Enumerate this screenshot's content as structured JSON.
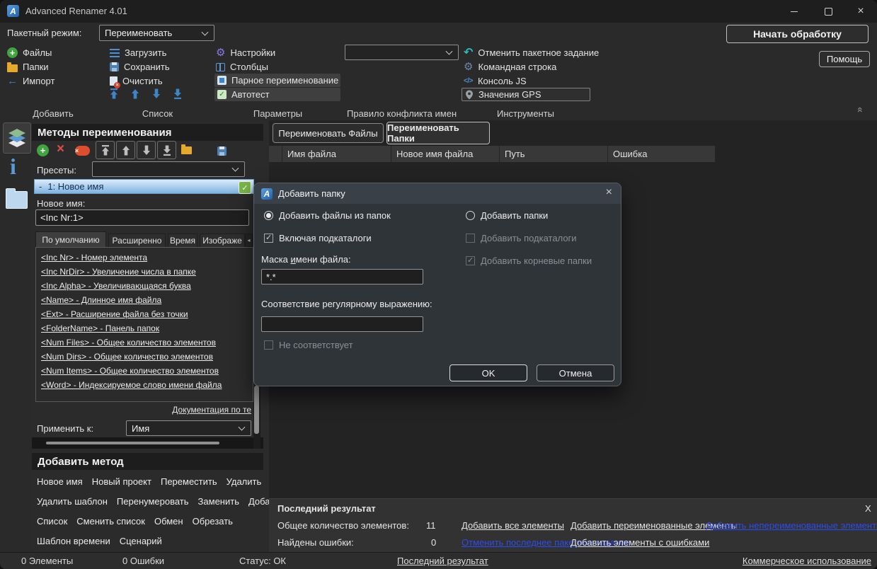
{
  "window": {
    "title": "Advanced Renamer 4.01"
  },
  "topbar": {
    "batch_mode_label": "Пакетный режим:",
    "batch_mode_value": "Переименовать",
    "start_button": "Начать обработку",
    "help_button": "Помощь"
  },
  "ribbon": {
    "groups": {
      "add": {
        "label": "Добавить",
        "files": "Файлы",
        "folders": "Папки",
        "import": "Импорт"
      },
      "list": {
        "label": "Список",
        "load": "Загрузить",
        "save": "Сохранить",
        "clear": "Очистить"
      },
      "params": {
        "label": "Параметры",
        "settings": "Настройки",
        "columns": "Столбцы",
        "pair": "Парное переименование",
        "autotest": "Автотест"
      },
      "conflict": {
        "label": "Правило конфликта имен",
        "combo_value": ""
      },
      "tools": {
        "label": "Инструменты",
        "undo_batch": "Отменить пакетное задание",
        "cmdline": "Командная строка",
        "jsconsole": "Консоль JS",
        "gps": "Значения GPS"
      }
    }
  },
  "methods_panel": {
    "title": "Методы переименования",
    "presets_label": "Пресеты:",
    "presets_value": "",
    "method_collapse": "-",
    "method_row": "1: Новое имя",
    "new_name_label": "Новое имя:",
    "new_name_value": "<Inc Nr:1>",
    "tabs": [
      "По умолчанию",
      "Расширенно",
      "Время",
      "Изображе"
    ],
    "tags": [
      "<Inc Nr> - Номер элемента",
      "<Inc NrDir> - Увеличение числа в папке",
      "<Inc Alpha> - Увеличивающаяся буква",
      "<Name> - Длинное имя файла",
      "<Ext> - Расширение файла без точки",
      "<FolderName> - Панель папок",
      "<Num Files> - Общее количество элементов",
      "<Num Dirs> - Общее количество элементов",
      "<Num Items> - Общее количество элементов",
      "<Word> - Индексируемое слово имени файла"
    ],
    "doc_link": "Документация по те",
    "apply_label": "Применить к:",
    "apply_value": "Имя"
  },
  "add_method_panel": {
    "title": "Добавить метод",
    "row1": [
      "Новое имя",
      "Новый проект",
      "Переместить",
      "Удалить"
    ],
    "row2": [
      "Удалить шаблон",
      "Перенумеровать",
      "Заменить",
      "Добавить"
    ],
    "row3": [
      "Список",
      "Сменить список",
      "Обмен",
      "Обрезать"
    ],
    "row4": [
      "Шаблон времени",
      "Сценарий"
    ]
  },
  "filelist": {
    "tab_files": "Переименовать Файлы",
    "tab_folders": "Переименовать Папки",
    "columns": [
      "Имя файла",
      "Новое имя файла",
      "Путь",
      "Ошибка"
    ]
  },
  "dialog": {
    "title": "Добавить папку",
    "radio_files": "Добавить файлы из папок",
    "radio_folders": "Добавить папки",
    "check_subdirs": "Включая подкаталоги",
    "check_add_subdirs": "Добавить подкаталоги",
    "check_add_root": "Добавить корневые папки",
    "mask_label_pre": "Маска ",
    "mask_label_u": "и",
    "mask_label_post": "мени файла:",
    "mask_value": "*.*",
    "regex_label": "Соответствие регулярному выражению:",
    "regex_value": "",
    "not_match_label": "Не соответствует",
    "ok_button": "OK",
    "cancel_button": "Отмена"
  },
  "result_panel": {
    "title": "Последний результат",
    "close": "X",
    "total_label": "Общее количество элементов:",
    "total_value": "11",
    "errors_label": "Найдены ошибки:",
    "errors_value": "0",
    "link_add_all": "Добавить все элементы",
    "link_add_renamed": "Добавить переименованные элементы",
    "link_add_unrenamed": "Добавить непереименованные элементы",
    "link_undo_last": "Отменить последнее пакетное задание",
    "link_add_errors": "Добавить элементы с ошибками"
  },
  "statusbar": {
    "elements": "0 Элементы",
    "errors": "0 Ошибки",
    "status": "Статус: ОК",
    "last_result": "Последний результат",
    "commercial": "Коммерческое использование"
  }
}
